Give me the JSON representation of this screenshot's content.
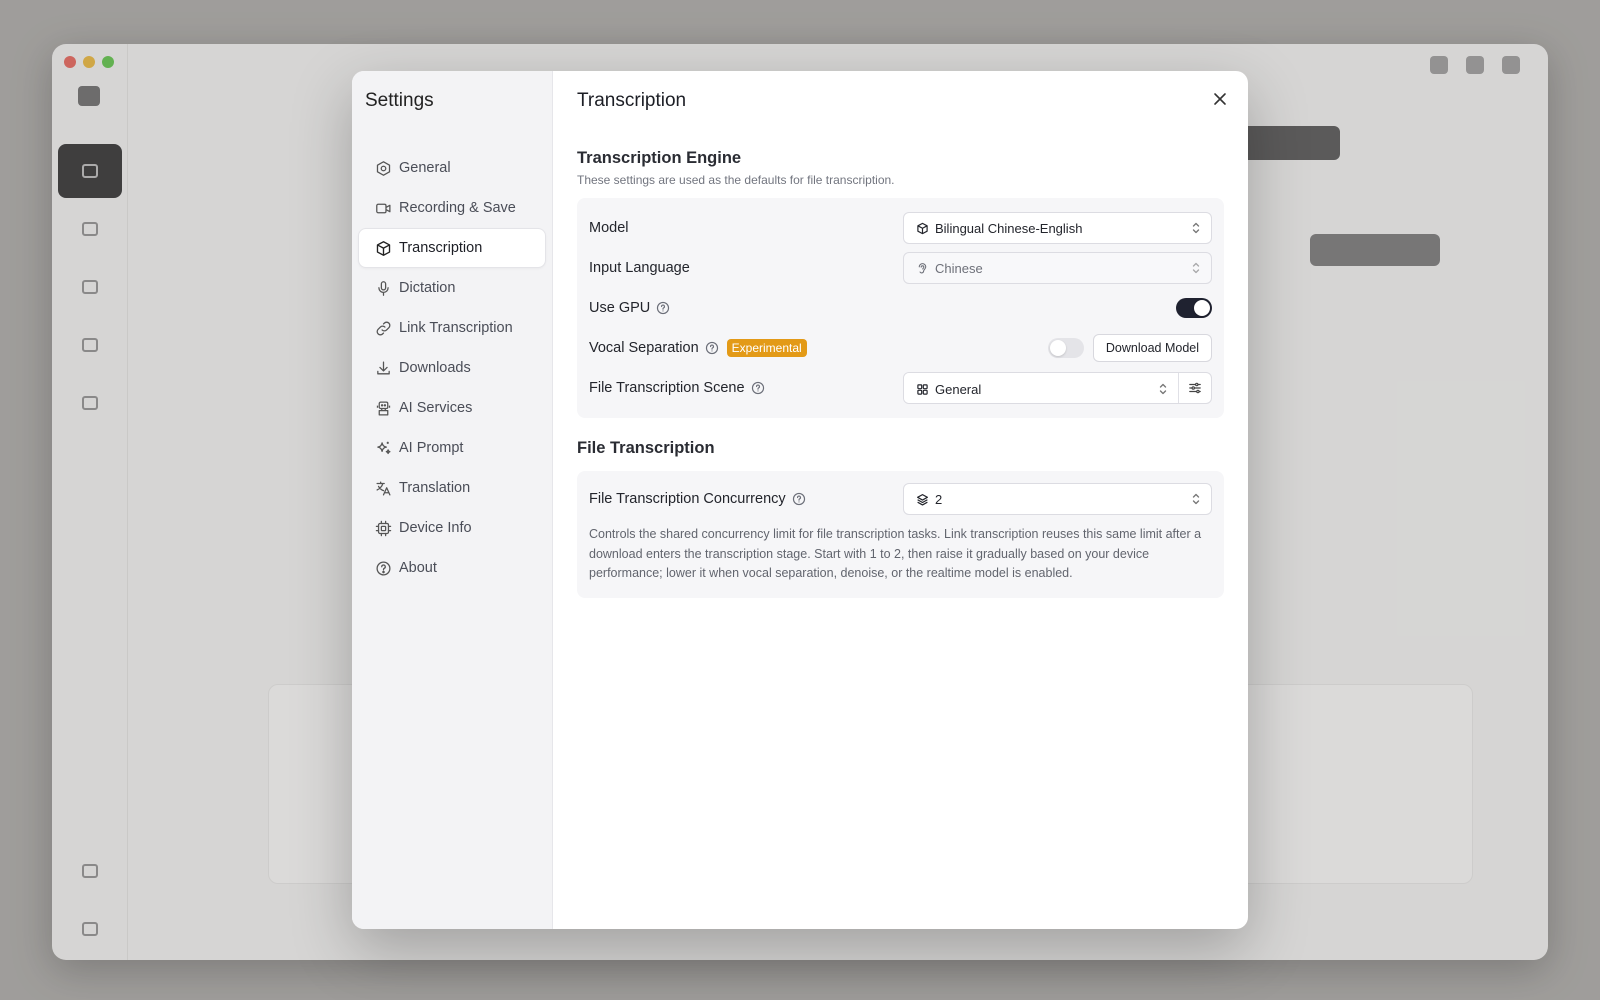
{
  "background": {
    "traffic_colors": [
      "#e0635a",
      "#e3b23c",
      "#5fbf4a"
    ]
  },
  "modal": {
    "sidebar_title": "Settings",
    "nav": [
      {
        "label": "General",
        "icon": "hexagon-gear-icon"
      },
      {
        "label": "Recording & Save",
        "icon": "video-camera-icon"
      },
      {
        "label": "Transcription",
        "icon": "cube-icon",
        "active": true
      },
      {
        "label": "Dictation",
        "icon": "microphone-icon"
      },
      {
        "label": "Link Transcription",
        "icon": "link-icon"
      },
      {
        "label": "Downloads",
        "icon": "download-icon"
      },
      {
        "label": "AI Services",
        "icon": "robot-icon"
      },
      {
        "label": "AI Prompt",
        "icon": "sparkles-icon"
      },
      {
        "label": "Translation",
        "icon": "translate-icon"
      },
      {
        "label": "Device Info",
        "icon": "cpu-chip-icon"
      },
      {
        "label": "About",
        "icon": "question-circle-icon"
      }
    ],
    "title": "Transcription",
    "engine": {
      "title": "Transcription Engine",
      "description": "These settings are used as the defaults for file transcription.",
      "model_label": "Model",
      "model_value": "Bilingual Chinese-English",
      "input_language_label": "Input Language",
      "input_language_value": "Chinese",
      "use_gpu_label": "Use GPU",
      "use_gpu_on": true,
      "vocal_separation_label": "Vocal Separation",
      "vocal_separation_badge": "Experimental",
      "vocal_separation_on": false,
      "download_model_label": "Download Model",
      "scene_label": "File Transcription Scene",
      "scene_value": "General"
    },
    "file_transcription": {
      "title": "File Transcription",
      "concurrency_label": "File Transcription Concurrency",
      "concurrency_value": "2",
      "concurrency_desc": "Controls the shared concurrency limit for file transcription tasks. Link transcription reuses this same limit after a download enters the transcription stage. Start with 1 to 2, then raise it gradually based on your device performance; lower it when vocal separation, denoise, or the realtime model is enabled."
    }
  },
  "colors": {
    "badge": "#e39a17",
    "toggle_on": "#1f2230",
    "active_nav_bg": "#ffffff"
  }
}
